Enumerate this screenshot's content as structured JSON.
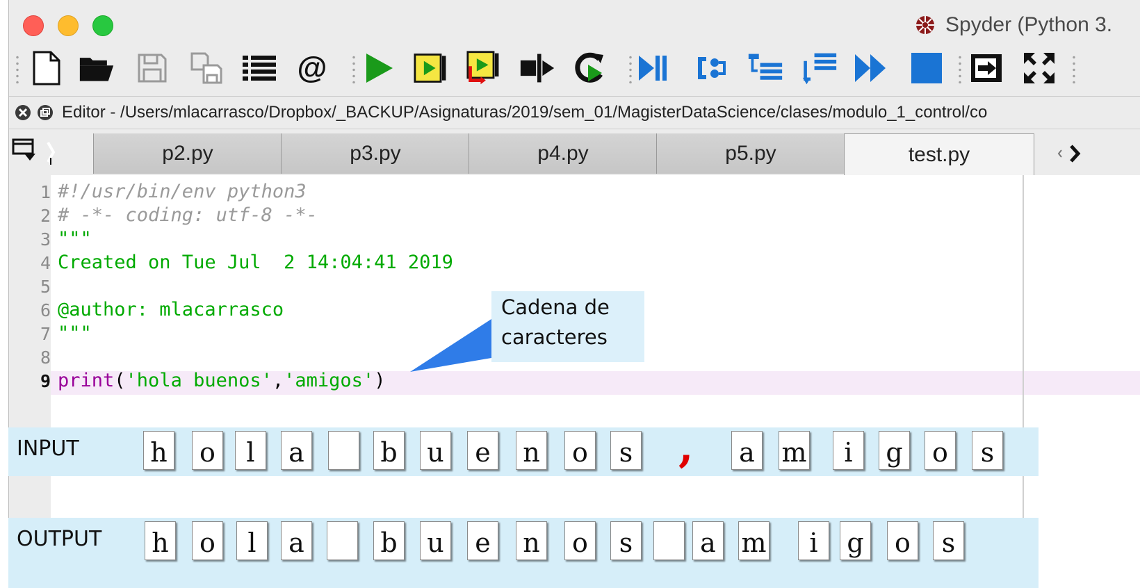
{
  "window": {
    "title": "Spyder (Python 3."
  },
  "toolbar": {
    "icons": [
      "new-file-icon",
      "open-folder-icon",
      "save-icon",
      "save-all-icon",
      "list-icon",
      "at-icon",
      "run-icon",
      "run-cell-icon",
      "run-cell-advance-icon",
      "run-selection-icon",
      "rerun-icon",
      "debug-icon",
      "step-icon",
      "step-into-icon",
      "step-return-icon",
      "continue-icon",
      "stop-icon",
      "maximize-pane-icon",
      "fullscreen-icon"
    ]
  },
  "editor": {
    "path": "Editor - /Users/mlacarrasco/Dropbox/_BACKUP/Asignaturas/2019/sem_01/MagisterDataScience/clases/modulo_1_control/co",
    "tabs": [
      {
        "label": "p2.py",
        "active": false
      },
      {
        "label": "p3.py",
        "active": false
      },
      {
        "label": "p4.py",
        "active": false
      },
      {
        "label": "p5.py",
        "active": false
      },
      {
        "label": "test.py",
        "active": true
      }
    ],
    "lines": [
      {
        "n": "1",
        "text": "#!/usr/bin/env python3"
      },
      {
        "n": "2",
        "text": "# -*- coding: utf-8 -*-"
      },
      {
        "n": "3",
        "text": "\"\"\""
      },
      {
        "n": "4",
        "text": "Created on Tue Jul  2 14:04:41 2019"
      },
      {
        "n": "5",
        "text": ""
      },
      {
        "n": "6",
        "text": "@author: mlacarrasco"
      },
      {
        "n": "7",
        "text": "\"\"\""
      },
      {
        "n": "8",
        "text": ""
      },
      {
        "n": "9",
        "print_kw": "print",
        "open": "(",
        "arg1": "'hola buenos'",
        "comma": ",",
        "arg2": "'amigos'",
        "close": ")"
      }
    ]
  },
  "callout": {
    "line1": "Cadena de",
    "line2": "caracteres"
  },
  "input_row": {
    "label": "INPUT",
    "chars": [
      "h",
      "o",
      "l",
      "a",
      " ",
      "b",
      "u",
      "e",
      "n",
      "o",
      "s",
      ",",
      "a",
      "m",
      "i",
      "g",
      "o",
      "s"
    ]
  },
  "output_row": {
    "label": "OUTPUT",
    "chars": [
      "h",
      "o",
      "l",
      "a",
      " ",
      "b",
      "u",
      "e",
      "n",
      "o",
      "s",
      " ",
      "a",
      "m",
      "i",
      "g",
      "o",
      "s"
    ]
  },
  "colors": {
    "close": "#ff5f57",
    "minimize": "#febc2e",
    "maximize": "#28c840",
    "string": "#00aa00",
    "keyword": "#990099",
    "comment": "#9a9a9a",
    "callout": "#dcf0fa",
    "callout_pointer": "#2f7ce8",
    "band": "#d6eef9",
    "comma": "#e00000"
  }
}
